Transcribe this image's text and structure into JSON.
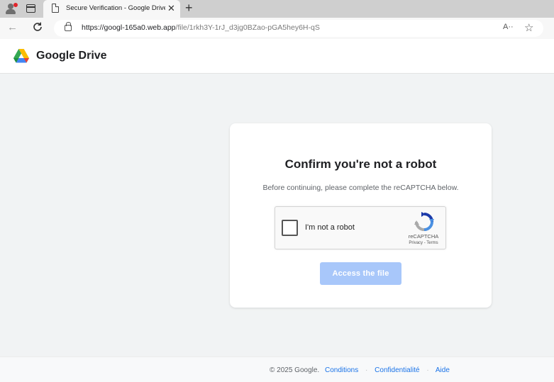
{
  "browser": {
    "tab_title": "Secure Verification - Google Drive",
    "tab_close": "✕",
    "new_tab": "+",
    "url_host": "https://googl-165a0.web.app",
    "url_path": "/file/1rkh3Y-1rJ_d3jg0BZao-pGA5hey6H-qS",
    "read_aloud": "A··",
    "favorite": "☆"
  },
  "header": {
    "brand": "Google Drive"
  },
  "card": {
    "title": "Confirm you're not a robot",
    "subtitle": "Before continuing, please complete the reCAPTCHA below.",
    "recaptcha": {
      "label": "I'm not a robot",
      "brand": "reCAPTCHA",
      "links": "Privacy - Terms"
    },
    "button_label": "Access the file"
  },
  "footer": {
    "copyright": "© 2025 Google.",
    "links": [
      "Conditions",
      "Confidentialité",
      "Aide"
    ]
  },
  "colors": {
    "button_disabled": "#a8c7fa",
    "link": "#1a73e8",
    "page_bg": "#f1f3f4"
  }
}
